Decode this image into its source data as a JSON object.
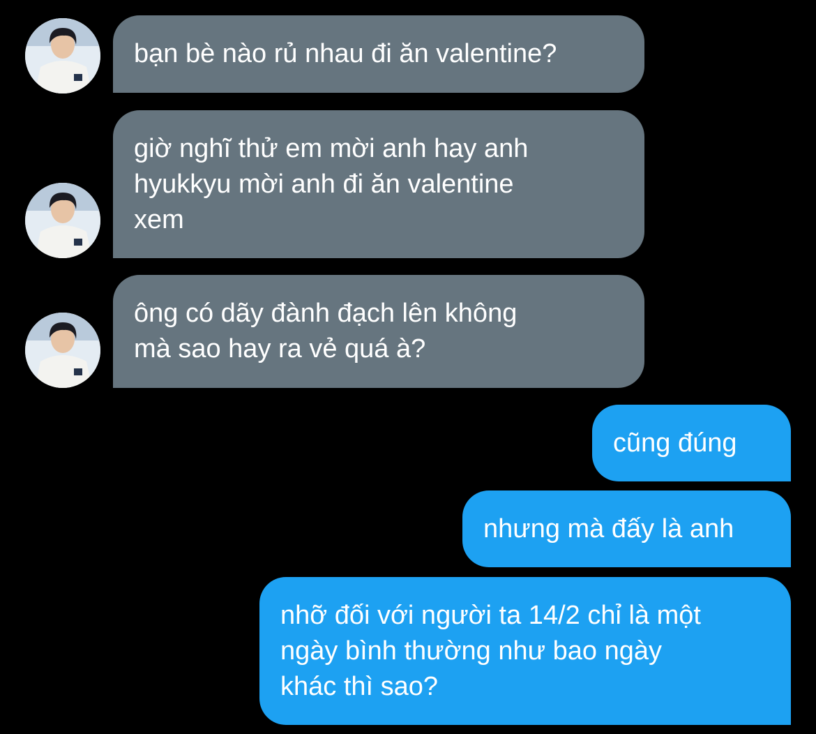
{
  "conversation": {
    "colors": {
      "received": "#66757f",
      "sent": "#1da1f2",
      "background": "#000000"
    },
    "messages": [
      {
        "direction": "received",
        "lines": [
          "bạn bè nào rủ nhau đi ăn valentine?"
        ]
      },
      {
        "direction": "received",
        "lines": [
          "giờ nghĩ thử em mời anh hay anh",
          "hyukkyu mời anh đi ăn valentine",
          "xem"
        ]
      },
      {
        "direction": "received",
        "lines": [
          "ông có dãy đành đạch lên không",
          "mà sao hay ra vẻ quá à?"
        ]
      },
      {
        "direction": "sent",
        "lines": [
          "cũng đúng"
        ]
      },
      {
        "direction": "sent",
        "lines": [
          "nhưng mà đấy là anh"
        ]
      },
      {
        "direction": "sent",
        "lines": [
          "nhỡ đối với người ta 14/2 chỉ là một",
          "ngày bình thường như bao ngày",
          "khác thì sao?"
        ]
      }
    ]
  }
}
